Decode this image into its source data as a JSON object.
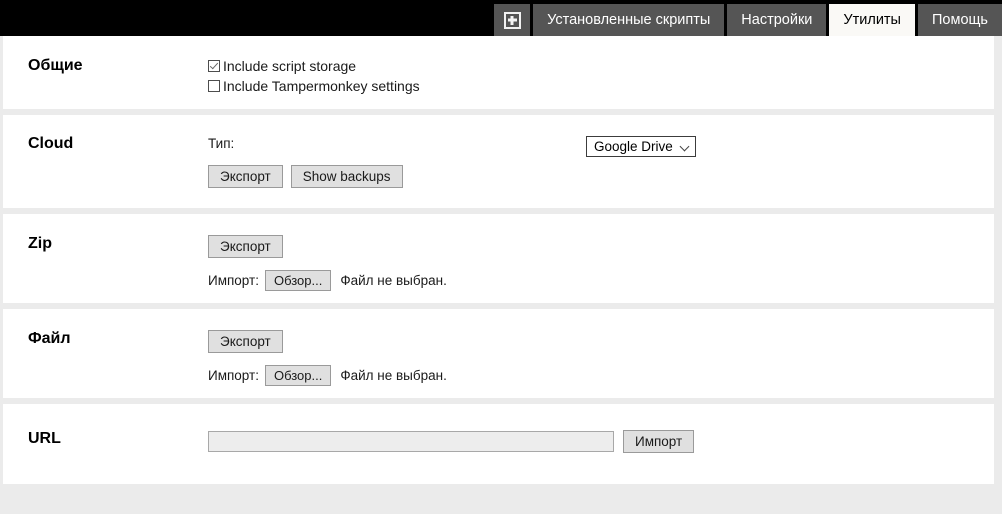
{
  "header": {
    "add_tab_icon": "plus-square-icon",
    "tabs": [
      {
        "label": "Установленные скрипты",
        "active": false
      },
      {
        "label": "Настройки",
        "active": false
      },
      {
        "label": "Утилиты",
        "active": true
      },
      {
        "label": "Помощь",
        "active": false
      }
    ]
  },
  "sections": {
    "general": {
      "title": "Общие",
      "checkboxes": [
        {
          "label": "Include script storage",
          "checked": true
        },
        {
          "label": "Include Tampermonkey settings",
          "checked": false
        }
      ]
    },
    "cloud": {
      "title": "Cloud",
      "type_label": "Тип:",
      "type_value": "Google Drive",
      "type_options": [
        "Google Drive"
      ],
      "dropdown_icon": "chevron-down-icon",
      "export_label": "Экспорт",
      "show_backups_label": "Show backups"
    },
    "zip": {
      "title": "Zip",
      "export_label": "Экспорт",
      "import_label": "Импорт:",
      "browse_label": "Обзор...",
      "file_status": "Файл не выбран."
    },
    "file": {
      "title": "Файл",
      "export_label": "Экспорт",
      "import_label": "Импорт:",
      "browse_label": "Обзор...",
      "file_status": "Файл не выбран."
    },
    "url": {
      "title": "URL",
      "input_value": "",
      "input_placeholder": "",
      "import_label": "Импорт"
    }
  },
  "colors": {
    "header_bg": "#000000",
    "tab_bg": "#555555",
    "tab_active_bg": "#faf9f6",
    "page_bg": "#ebebeb",
    "panel_bg": "#ffffff",
    "button_bg": "#e0e0e0"
  }
}
